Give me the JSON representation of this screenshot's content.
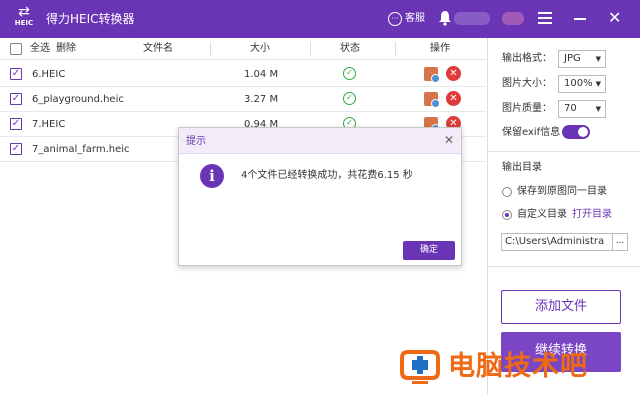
{
  "app": {
    "logo_text": "HEIC",
    "title": "得力HEIC转换器",
    "service_label": "客服",
    "brand_color": "#6a35b5"
  },
  "list": {
    "header": {
      "select_all": "全选",
      "delete": "删除",
      "filename": "文件名",
      "size": "大小",
      "status": "状态",
      "actions": "操作"
    },
    "rows": [
      {
        "name": "6.HEIC",
        "size": "1.04 M",
        "checked": true,
        "status": "success"
      },
      {
        "name": "6_playground.heic",
        "size": "3.27 M",
        "checked": true,
        "status": "success"
      },
      {
        "name": "7.HEIC",
        "size": "0.94 M",
        "checked": true,
        "status": "success"
      },
      {
        "name": "7_animal_farm.heic",
        "size": "",
        "checked": true,
        "status": ""
      }
    ]
  },
  "settings": {
    "format_label": "输出格式：",
    "format_value": "JPG",
    "size_label": "图片大小：",
    "size_value": "100%",
    "quality_label": "图片质量：",
    "quality_value": "70",
    "exif_label": "保留exif信息",
    "exif_on": true,
    "output_dir_title": "输出目录",
    "same_dir_label": "保存到原图同一目录",
    "custom_dir_label": "自定义目录",
    "open_dir_label": "打开目录",
    "path_value": "C:\\Users\\Administra",
    "browse_label": "...",
    "add_file_label": "添加文件",
    "convert_label": "继续转换"
  },
  "dialog": {
    "title": "提示",
    "message": "4个文件已经转换成功，共花费6.15 秒",
    "ok_label": "确定"
  },
  "watermark": {
    "text": "电脑技术吧"
  }
}
